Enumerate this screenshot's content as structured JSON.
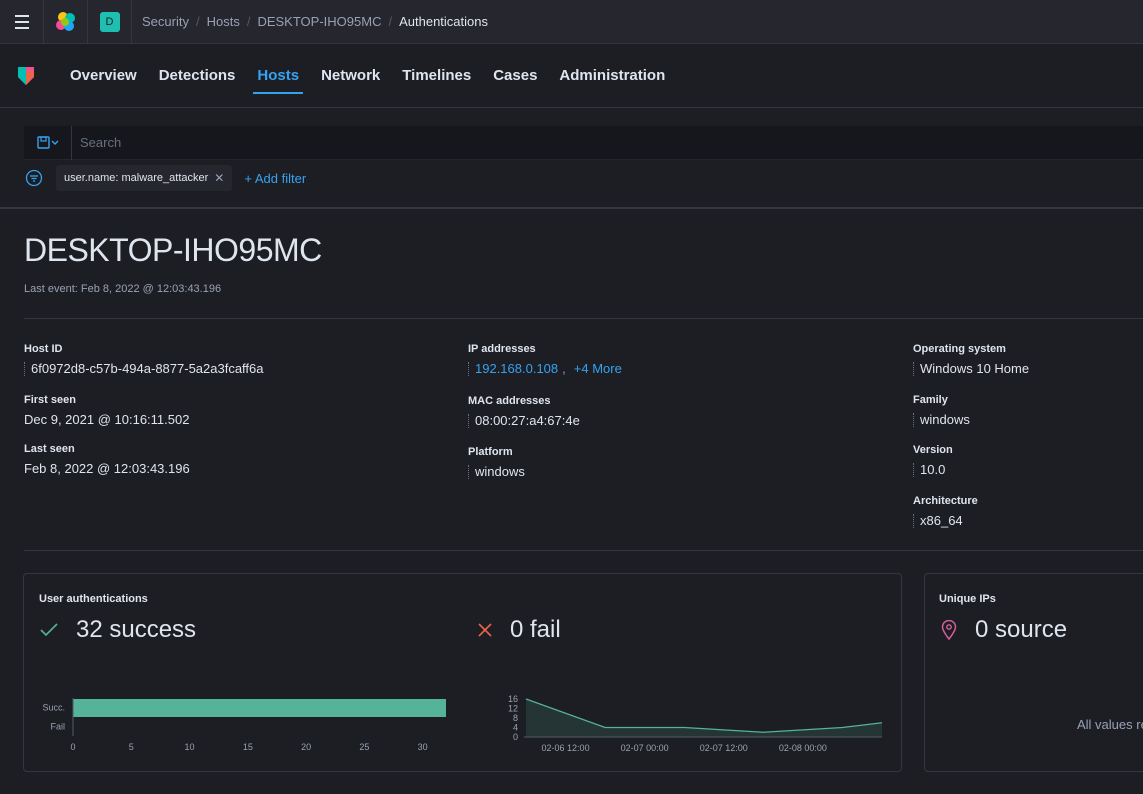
{
  "header": {
    "space_letter": "D",
    "breadcrumbs": [
      "Security",
      "Hosts",
      "DESKTOP-IHO95MC",
      "Authentications"
    ]
  },
  "nav": {
    "tabs": [
      {
        "label": "Overview",
        "active": false
      },
      {
        "label": "Detections",
        "active": false
      },
      {
        "label": "Hosts",
        "active": true
      },
      {
        "label": "Network",
        "active": false
      },
      {
        "label": "Timelines",
        "active": false
      },
      {
        "label": "Cases",
        "active": false
      },
      {
        "label": "Administration",
        "active": false
      }
    ]
  },
  "search": {
    "placeholder": "Search"
  },
  "filters": {
    "pill_label": "user.name: malware_attacker",
    "add_filter_label": "+ Add filter"
  },
  "host": {
    "name": "DESKTOP-IHO95MC",
    "last_event": "Last event: Feb 8, 2022 @ 12:03:43.196"
  },
  "overview": {
    "host_id_label": "Host ID",
    "host_id": "6f0972d8-c57b-494a-8877-5a2a3fcaff6a",
    "first_seen_label": "First seen",
    "first_seen": "Dec 9, 2021 @ 10:16:11.502",
    "last_seen_label": "Last seen",
    "last_seen": "Feb 8, 2022 @ 12:03:43.196",
    "ip_label": "IP addresses",
    "ip": "192.168.0.108",
    "ip_more": "+4 More",
    "mac_label": "MAC addresses",
    "mac": "08:00:27:a4:67:4e",
    "platform_label": "Platform",
    "platform": "windows",
    "os_label": "Operating system",
    "os": "Windows 10 Home",
    "family_label": "Family",
    "family": "windows",
    "version_label": "Version",
    "version": "10.0",
    "arch_label": "Architecture",
    "arch": "x86_64"
  },
  "kpi": {
    "auth_title": "User authentications",
    "success_text": "32 success",
    "fail_text": "0 fail",
    "ips_title": "Unique IPs",
    "source_text": "0 source",
    "empty_text": "All values re"
  },
  "colors": {
    "accent": "#36a2ef",
    "success": "#54b399",
    "fail": "#e7664c",
    "source": "#d6609a"
  },
  "chart_data": [
    {
      "type": "bar",
      "orientation": "horizontal",
      "categories": [
        "Succ.",
        "Fail"
      ],
      "values": [
        32,
        0
      ],
      "xlim": [
        0,
        32
      ],
      "x_ticks": [
        0,
        5,
        10,
        15,
        20,
        25,
        30
      ]
    },
    {
      "type": "area",
      "x": [
        "02-06 06:00",
        "02-06 18:00",
        "02-07 06:00",
        "02-07 18:00",
        "02-08 06:00",
        "02-08 12:00"
      ],
      "y": [
        16,
        4,
        4,
        2,
        4,
        6
      ],
      "x_tick_labels": [
        "02-06 12:00",
        "02-07 00:00",
        "02-07 12:00",
        "02-08 00:00"
      ],
      "y_ticks": [
        0,
        4,
        8,
        12,
        16
      ],
      "ylim": [
        0,
        16
      ]
    }
  ]
}
